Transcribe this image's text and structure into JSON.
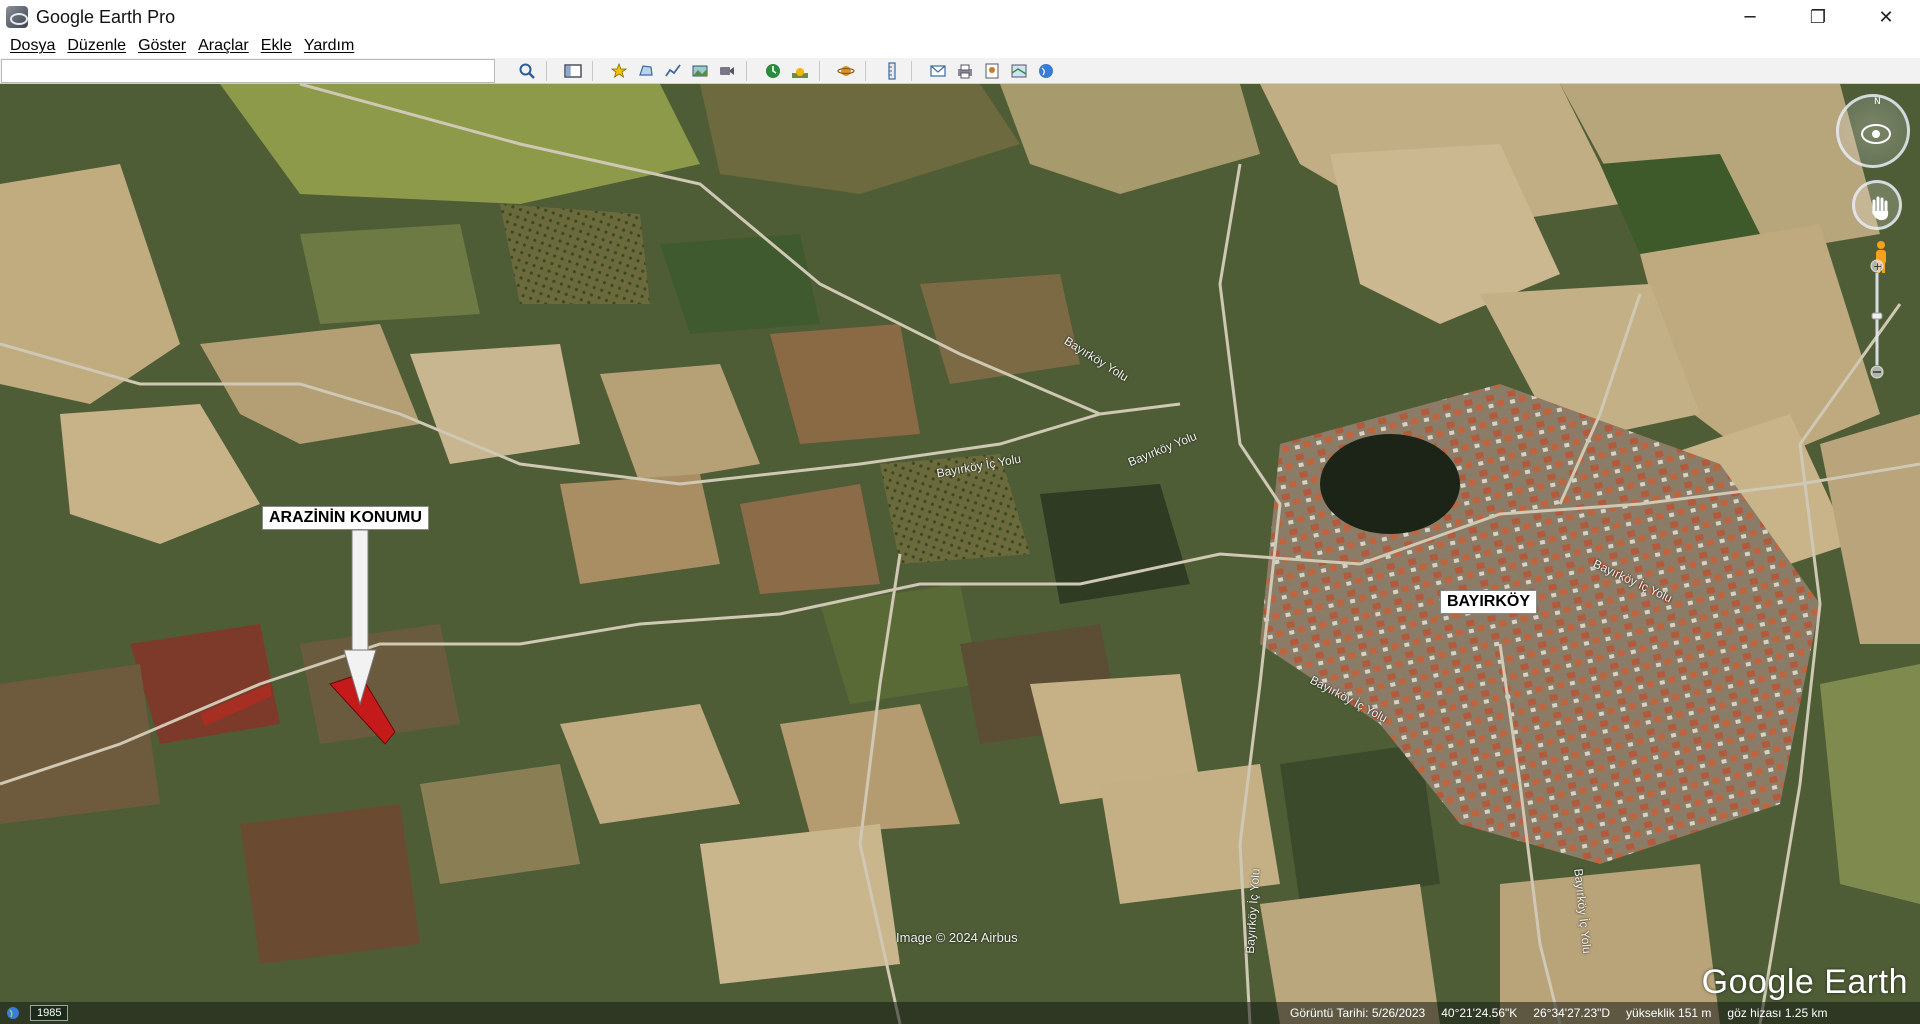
{
  "window": {
    "title": "Google Earth Pro",
    "minimize_glyph": "─",
    "maximize_glyph": "❐",
    "close_glyph": "✕"
  },
  "menu": {
    "items": [
      "Dosya",
      "Düzenle",
      "Göster",
      "Araçlar",
      "Ekle",
      "Yardım"
    ]
  },
  "toolbar": {
    "search_value": "",
    "search_placeholder": "",
    "buttons": [
      "search-icon",
      "sidebar-toggle-icon",
      "add-placemark-icon",
      "add-polygon-icon",
      "add-path-icon",
      "add-image-overlay-icon",
      "record-tour-icon",
      "historical-imagery-icon",
      "sunlight-icon",
      "switch-planet-icon",
      "ruler-icon",
      "email-icon",
      "print-icon",
      "save-image-icon",
      "view-in-maps-icon",
      "globe-icon"
    ]
  },
  "map": {
    "annotations": {
      "land_label": "ARAZİNİN KONUMU",
      "village_label": "BAYIRKÖY"
    },
    "road_labels": [
      "Bayırköy Yolu",
      "Bayırköy İç Yolu",
      "Bayırköy Yolu",
      "Bayırköy İç Yolu",
      "Bayırköy İç Yolu",
      "Bayırköy İç Yolu",
      "Bayırköy İç Yolu"
    ],
    "attribution": "Image © 2024 Airbus",
    "logo": "Google Earth"
  },
  "status": {
    "year": "1985",
    "imagery_date": "Görüntü Tarihi: 5/26/2023",
    "latitude": "40°21'24.56\"K",
    "longitude": "26°34'27.23\"D",
    "elevation": "yükseklik  151 m",
    "eye_altitude": "göz hizası  1.25 km"
  },
  "colors": {
    "highlight_parcel": "#c41a1a",
    "terrain_base": "#4b5a34"
  }
}
